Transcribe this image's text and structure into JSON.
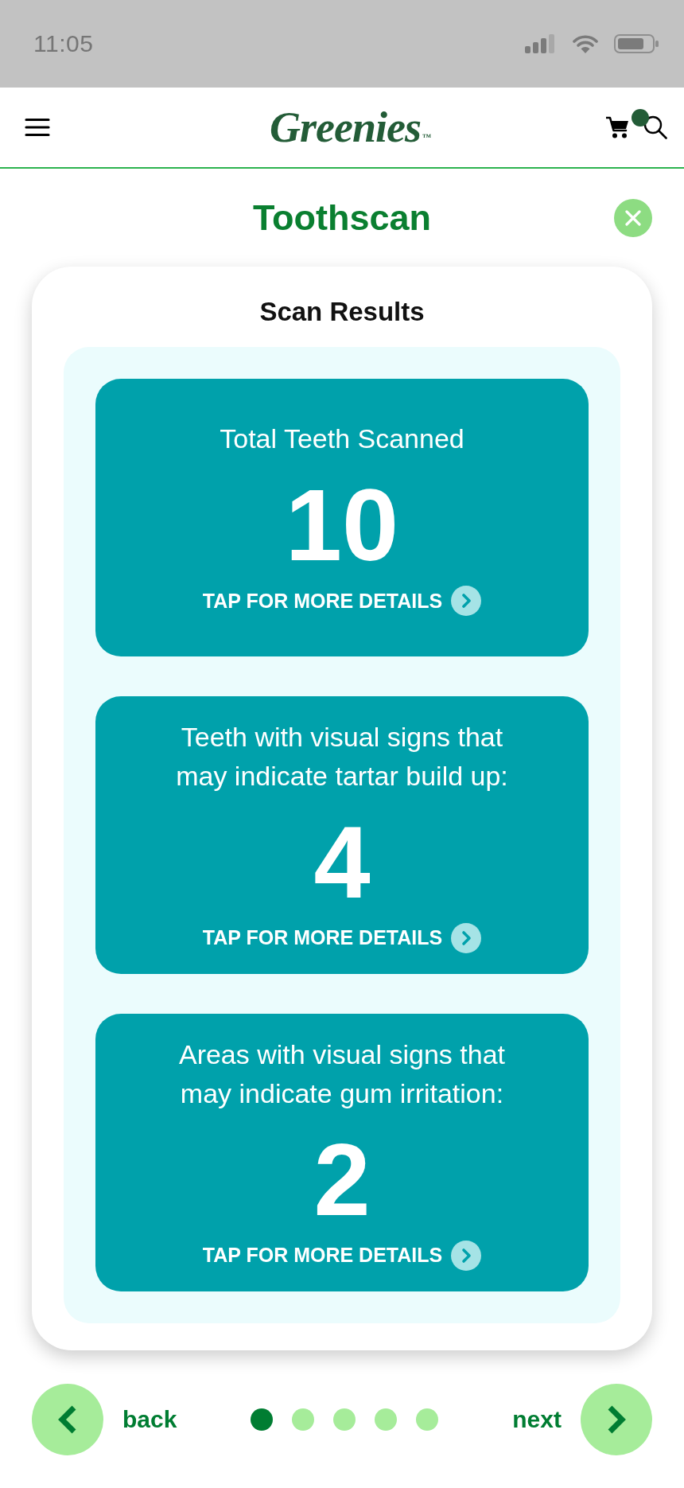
{
  "status_bar": {
    "time": "11:05"
  },
  "header": {
    "logo": "Greenies",
    "trademark": "™"
  },
  "page": {
    "title": "Toothscan"
  },
  "results": {
    "title": "Scan Results",
    "cards": [
      {
        "label": "Total Teeth Scanned",
        "value": "10",
        "link": "TAP FOR MORE DETAILS"
      },
      {
        "label": "Teeth with visual signs that may indicate tartar build up:",
        "value": "4",
        "link": "TAP FOR MORE DETAILS"
      },
      {
        "label": "Areas with visual signs that may indicate gum irritation:",
        "value": "2",
        "link": "TAP FOR MORE DETAILS"
      }
    ]
  },
  "pager": {
    "back": "back",
    "next": "next",
    "steps": [
      {
        "selected": true
      },
      {
        "selected": false
      },
      {
        "selected": false
      },
      {
        "selected": false
      },
      {
        "selected": false
      }
    ]
  }
}
